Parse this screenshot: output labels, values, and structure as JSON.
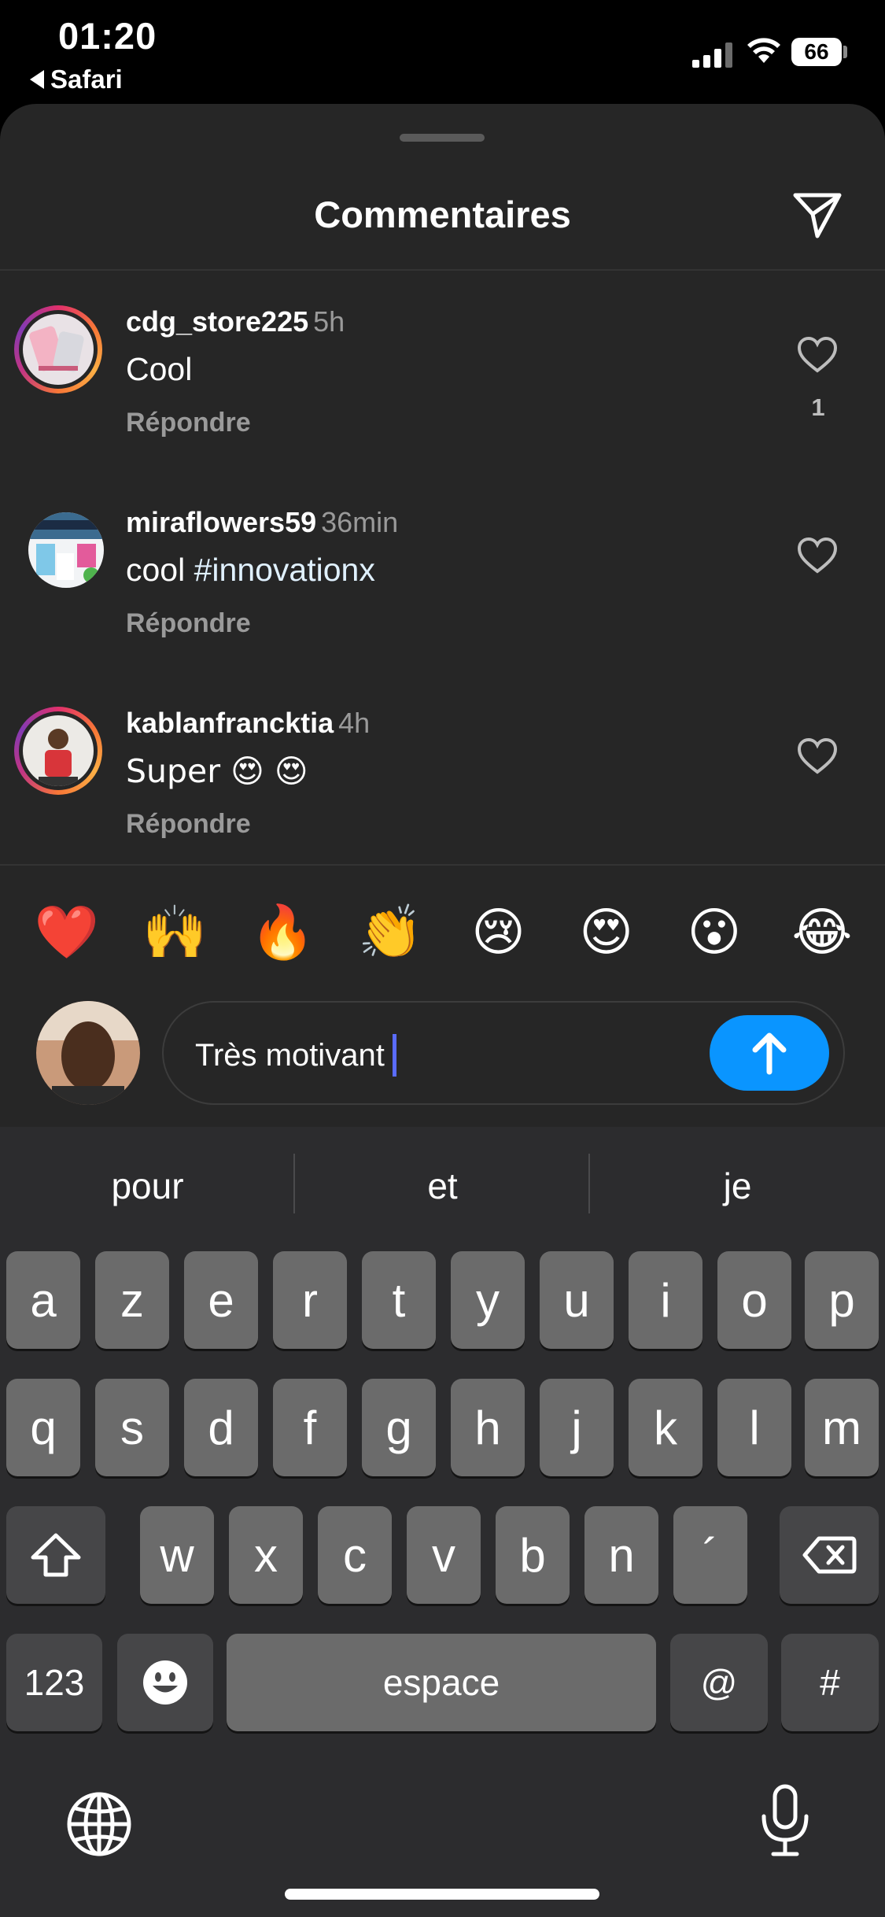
{
  "status_bar": {
    "time": "01:20",
    "back_app": "Safari",
    "battery": "66"
  },
  "sheet": {
    "title": "Commentaires",
    "share_icon": "paper-plane-icon"
  },
  "comments": [
    {
      "user": "cdg_store225",
      "time": "5h",
      "text": "Cool",
      "hashtag": "",
      "reply": "Répondre",
      "likes": "1",
      "story_ring": true
    },
    {
      "user": "miraflowers59",
      "time": "36min",
      "text": "cool ",
      "hashtag": "#innovationx",
      "reply": "Répondre",
      "likes": "",
      "story_ring": false
    },
    {
      "user": "kablanfrancktia",
      "time": "4h",
      "text": "Super 😍 😍",
      "hashtag": "",
      "reply": "Répondre",
      "likes": "",
      "story_ring": true
    }
  ],
  "quick_emojis": [
    "❤️",
    "🙌",
    "🔥",
    "👏",
    "😢",
    "😍",
    "😮",
    "😂"
  ],
  "composer": {
    "value": "Très motivant",
    "send_icon": "arrow-up-icon"
  },
  "keyboard": {
    "suggestions": [
      "pour",
      "et",
      "je"
    ],
    "row1": [
      "a",
      "z",
      "e",
      "r",
      "t",
      "y",
      "u",
      "i",
      "o",
      "p"
    ],
    "row2": [
      "q",
      "s",
      "d",
      "f",
      "g",
      "h",
      "j",
      "k",
      "l",
      "m"
    ],
    "row3": [
      "w",
      "x",
      "c",
      "v",
      "b",
      "n",
      "´"
    ],
    "numbers_key": "123",
    "space_key": "espace",
    "at_key": "@",
    "hash_key": "#"
  },
  "colors": {
    "sheet_bg": "#262626",
    "accent_blue": "#0a95ff",
    "key_bg": "#6b6b6b",
    "keyboard_bg": "#2c2c2e"
  }
}
